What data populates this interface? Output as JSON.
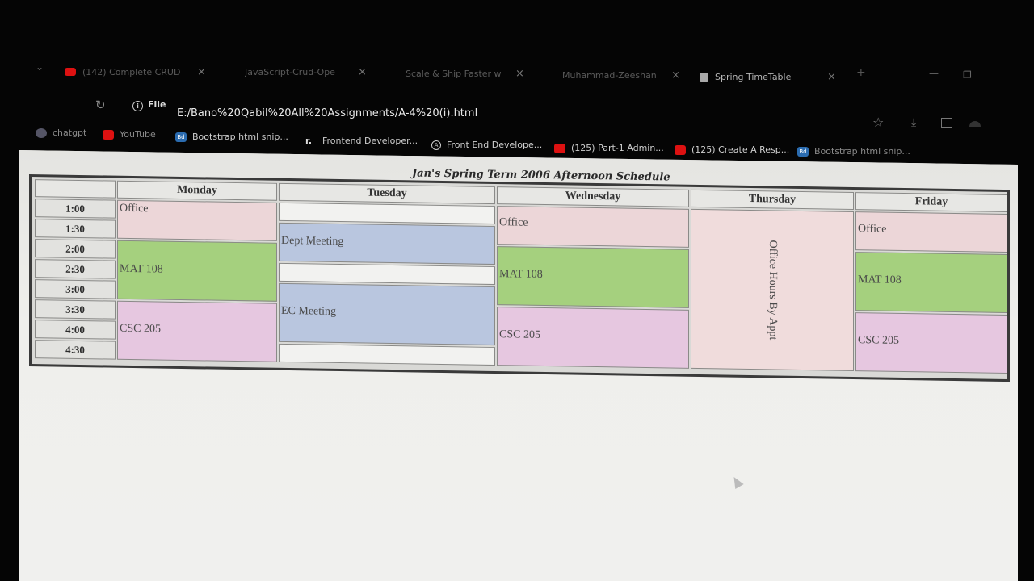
{
  "browser": {
    "tabs": [
      {
        "title": "(142) Complete CRUD",
        "icon": "youtube-icon"
      },
      {
        "title": "JavaScript-Crud-Ope",
        "icon": "none"
      },
      {
        "title": "Scale & Ship Faster w",
        "icon": "none"
      },
      {
        "title": "Muhammad-Zeeshan",
        "icon": "none"
      },
      {
        "title": "Spring TimeTable",
        "icon": "page-icon",
        "active": true
      }
    ],
    "close_glyph": "×",
    "file_label": "File",
    "url": "E:/Bano%20Qabil%20All%20Assignments/A-4%20(i).html",
    "bookmarks": [
      {
        "label": "chatgpt",
        "icon": "gpt"
      },
      {
        "label": "YouTube",
        "icon": "yt"
      },
      {
        "label": "Bootstrap html snip...",
        "icon": "bd"
      },
      {
        "label": "Frontend Developer...",
        "icon": "fr"
      },
      {
        "label": "Front End Develope...",
        "icon": "fe"
      },
      {
        "label": "(125) Part-1 Admin...",
        "icon": "yt"
      },
      {
        "label": "(125) Create A Resp...",
        "icon": "yt"
      },
      {
        "label": "Bootstrap html snip...",
        "icon": "bd"
      }
    ]
  },
  "schedule": {
    "caption": "Jan's Spring Term 2006 Afternoon Schedule",
    "days": [
      "Monday",
      "Tuesday",
      "Wednesday",
      "Thursday",
      "Friday"
    ],
    "times": [
      "1:00",
      "1:30",
      "2:00",
      "2:30",
      "3:00",
      "3:30",
      "4:00",
      "4:30"
    ],
    "events": {
      "monday": [
        "Office",
        "MAT 108",
        "CSC 205"
      ],
      "tuesday": [
        "",
        "Dept Meeting",
        "",
        "EC Meeting",
        ""
      ],
      "wednesday": [
        "Office",
        "MAT 108",
        "CSC 205"
      ],
      "thursday": [
        "Office Hours By Appt"
      ],
      "friday": [
        "Office",
        "MAT 108",
        "CSC 205"
      ]
    },
    "colors": {
      "office": "#ecd6d8",
      "mat": "#a5d07e",
      "csc": "#e6c7e0",
      "meeting": "#b9c6df"
    }
  }
}
